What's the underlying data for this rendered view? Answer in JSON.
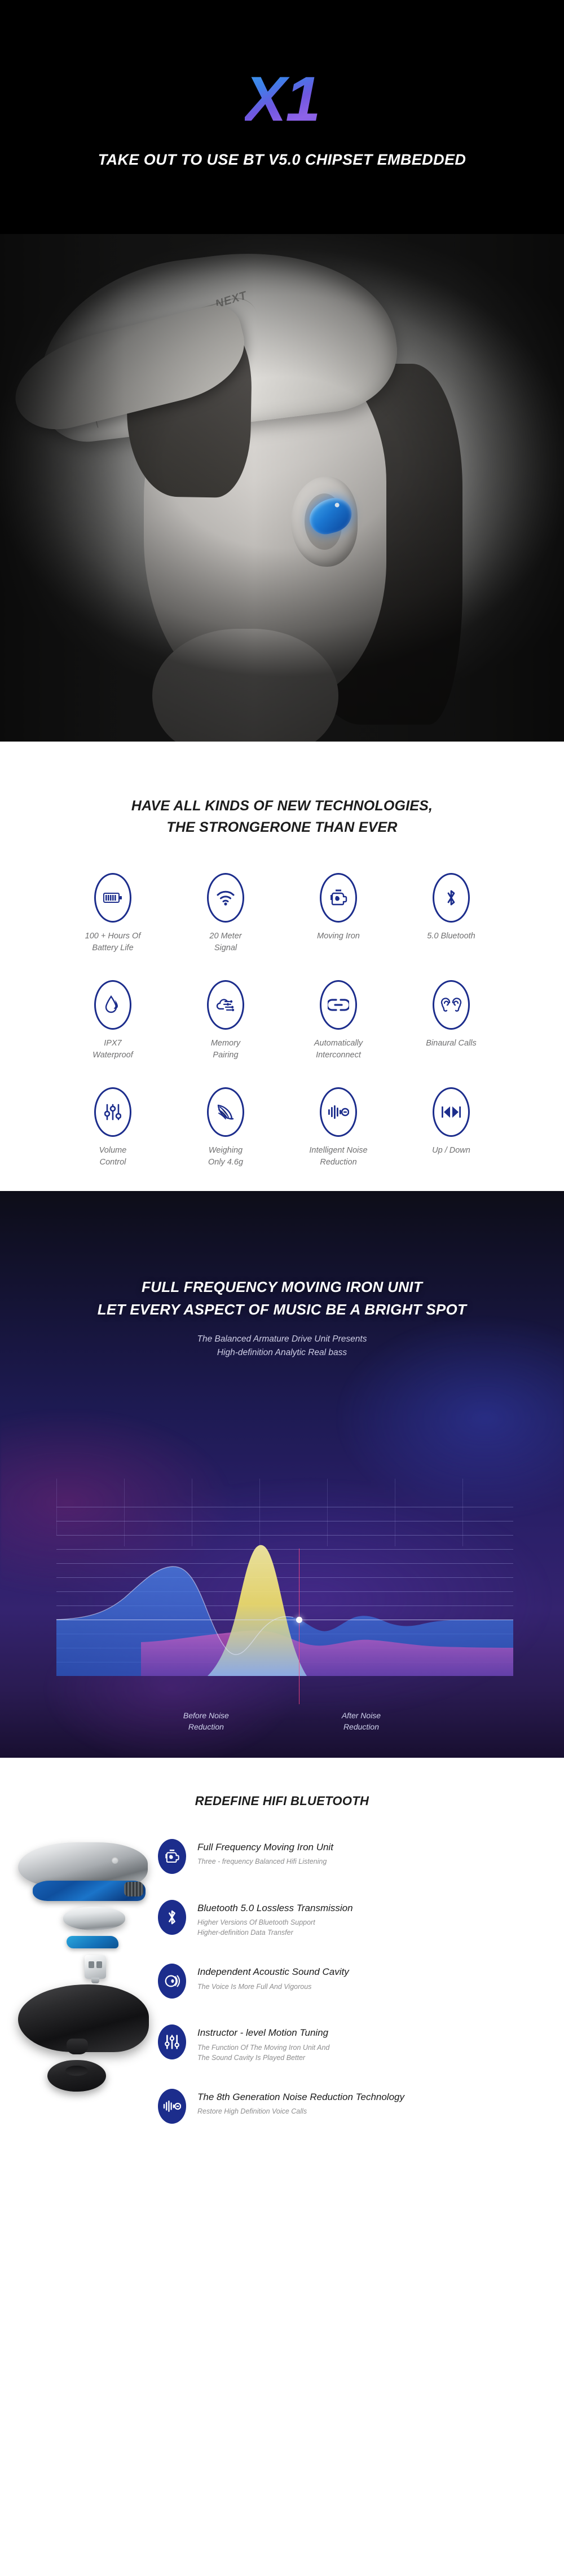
{
  "hero": {
    "logo": "X1",
    "tagline": "TAKE OUT TO USE BT V5.0 CHIPSET EMBEDDED",
    "photo_alt": "woman-wearing-white-cap-with-blue-earbud",
    "cap_text": "NEXT"
  },
  "features_section": {
    "title_line1": "HAVE ALL KINDS OF NEW TECHNOLOGIES,",
    "title_line2": "THE STRONGERONE THAN EVER",
    "accent_color": "#1c2d8c",
    "items": [
      {
        "icon": "battery-icon",
        "label": "100 + Hours Of\nBattery Life"
      },
      {
        "icon": "wifi-signal-icon",
        "label": "20 Meter\nSignal"
      },
      {
        "icon": "moving-iron-icon",
        "label": "Moving Iron"
      },
      {
        "icon": "bluetooth-icon",
        "label": "5.0 Bluetooth"
      },
      {
        "icon": "water-drop-icon",
        "label": "IPX7\nWaterproof"
      },
      {
        "icon": "memory-chip-icon",
        "label": "Memory\nPairing"
      },
      {
        "icon": "link-connect-icon",
        "label": "Automatically\nInterconnect"
      },
      {
        "icon": "two-ears-icon",
        "label": "Binaural Calls"
      },
      {
        "icon": "sliders-icon",
        "label": "Volume\nControl"
      },
      {
        "icon": "feather-icon",
        "label": "Weighing\nOnly 4.6g"
      },
      {
        "icon": "noise-reduction-icon",
        "label": "Intelligent Noise\nReduction"
      },
      {
        "icon": "prev-next-track-icon",
        "label": "Up / Down"
      }
    ]
  },
  "wave_section": {
    "title_line1": "FULL FREQUENCY MOVING IRON UNIT",
    "title_line2": "LET EVERY ASPECT OF MUSIC BE A BRIGHT SPOT",
    "subtitle_line1": "The Balanced Armature Drive Unit Presents",
    "subtitle_line2": "High-definition Analytic Real bass",
    "label_left": "Before Noise\nReduction",
    "label_right": "After  Noise\nReduction"
  },
  "chart_data": {
    "type": "area",
    "title": "Before / After Noise Reduction frequency response",
    "xlabel": "",
    "ylabel": "",
    "grid": true,
    "legend": [
      "Before Noise Reduction",
      "After Noise Reduction"
    ],
    "legend_position": "below-axis",
    "xlim": [
      0,
      100
    ],
    "ylim": [
      -40,
      100
    ],
    "marker_x": 41,
    "series": [
      {
        "name": "Yellow peak (moving iron response)",
        "color": "#f2e36a",
        "x": [
          20,
          26,
          31,
          36,
          41,
          46,
          52,
          58,
          64,
          70,
          78,
          86,
          94
        ],
        "values": [
          0,
          6,
          28,
          72,
          96,
          60,
          18,
          4,
          2,
          1,
          1,
          0,
          0
        ]
      },
      {
        "name": "Blue wave (before noise reduction)",
        "color": "#3f7ee8",
        "x": [
          4,
          10,
          16,
          22,
          28,
          34,
          40,
          46,
          52,
          58,
          64,
          70,
          76,
          82,
          88,
          94
        ],
        "values": [
          -2,
          2,
          10,
          40,
          62,
          52,
          14,
          -34,
          -18,
          16,
          6,
          -10,
          -4,
          2,
          0,
          0
        ]
      },
      {
        "name": "Magenta wave (after noise reduction)",
        "color": "#d04fb4",
        "x": [
          28,
          34,
          40,
          46,
          52,
          58,
          64,
          70,
          76,
          82,
          88,
          94
        ],
        "values": [
          0,
          8,
          16,
          10,
          4,
          14,
          6,
          2,
          5,
          2,
          0,
          0
        ]
      }
    ]
  },
  "redefine_section": {
    "title": "REDEFINE HIFI BLUETOOTH",
    "product_alt": "exploded-view-earbud-components",
    "items": [
      {
        "icon": "moving-iron-icon",
        "title": "Full Frequency Moving Iron Unit",
        "desc": "Three - frequency Balanced Hifi Listening"
      },
      {
        "icon": "bluetooth-icon",
        "title": "Bluetooth 5.0 Lossless Transmission",
        "desc": "Higher Versions Of Bluetooth Support\nHigher-definition Data Transfer"
      },
      {
        "icon": "sound-cavity-icon",
        "title": "Independent Acoustic Sound Cavity",
        "desc": "The Voice Is More Full And Vigorous"
      },
      {
        "icon": "sliders-icon",
        "title": "Instructor - level Motion Tuning",
        "desc": "The Function Of The Moving Iron Unit And\nThe Sound Cavity Is Played Better"
      },
      {
        "icon": "noise-reduction-icon",
        "title": "The 8th Generation Noise Reduction Technology",
        "desc": "Restore High Definition Voice Calls"
      }
    ]
  }
}
